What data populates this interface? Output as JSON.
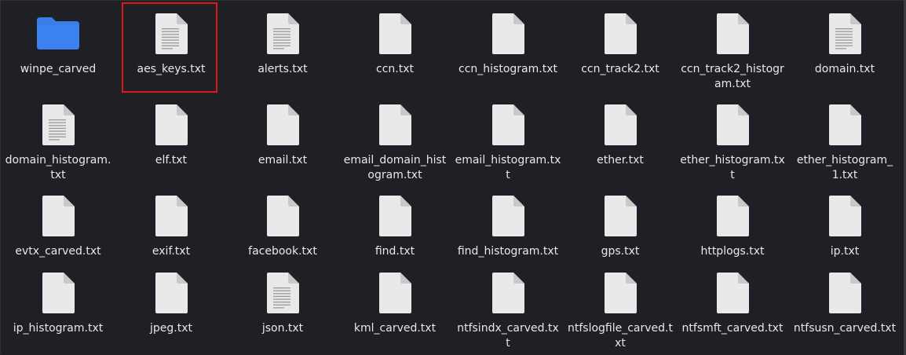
{
  "items": [
    {
      "name": "winpe_carved",
      "type": "folder"
    },
    {
      "name": "aes_keys.txt",
      "type": "text-lines",
      "selected": true
    },
    {
      "name": "alerts.txt",
      "type": "text-lines"
    },
    {
      "name": "ccn.txt",
      "type": "blank"
    },
    {
      "name": "ccn_histogram.txt",
      "type": "blank"
    },
    {
      "name": "ccn_track2.txt",
      "type": "blank"
    },
    {
      "name": "ccn_track2_histogram.txt",
      "type": "blank"
    },
    {
      "name": "domain.txt",
      "type": "text-lines"
    },
    {
      "name": "domain_histogram.txt",
      "type": "text-lines"
    },
    {
      "name": "elf.txt",
      "type": "blank"
    },
    {
      "name": "email.txt",
      "type": "blank"
    },
    {
      "name": "email_domain_histogram.txt",
      "type": "blank"
    },
    {
      "name": "email_histogram.txt",
      "type": "blank"
    },
    {
      "name": "ether.txt",
      "type": "blank"
    },
    {
      "name": "ether_histogram.txt",
      "type": "blank"
    },
    {
      "name": "ether_histogram_1.txt",
      "type": "blank"
    },
    {
      "name": "evtx_carved.txt",
      "type": "blank"
    },
    {
      "name": "exif.txt",
      "type": "blank"
    },
    {
      "name": "facebook.txt",
      "type": "blank"
    },
    {
      "name": "find.txt",
      "type": "blank"
    },
    {
      "name": "find_histogram.txt",
      "type": "blank"
    },
    {
      "name": "gps.txt",
      "type": "blank"
    },
    {
      "name": "httplogs.txt",
      "type": "blank"
    },
    {
      "name": "ip.txt",
      "type": "blank"
    },
    {
      "name": "ip_histogram.txt",
      "type": "blank"
    },
    {
      "name": "jpeg.txt",
      "type": "blank"
    },
    {
      "name": "json.txt",
      "type": "text-lines"
    },
    {
      "name": "kml_carved.txt",
      "type": "blank"
    },
    {
      "name": "ntfsindx_carved.txt",
      "type": "blank"
    },
    {
      "name": "ntfslogfile_carved.txt",
      "type": "blank"
    },
    {
      "name": "ntfsmft_carved.txt",
      "type": "blank"
    },
    {
      "name": "ntfsusn_carved.txt",
      "type": "blank"
    }
  ],
  "colors": {
    "background": "#1f2025",
    "folder": "#3a7ee6",
    "file": "#e9e9e9",
    "file_fold": "#c9c9c9",
    "text_lines": "#9a9a9a",
    "highlight": "#e0161b"
  }
}
